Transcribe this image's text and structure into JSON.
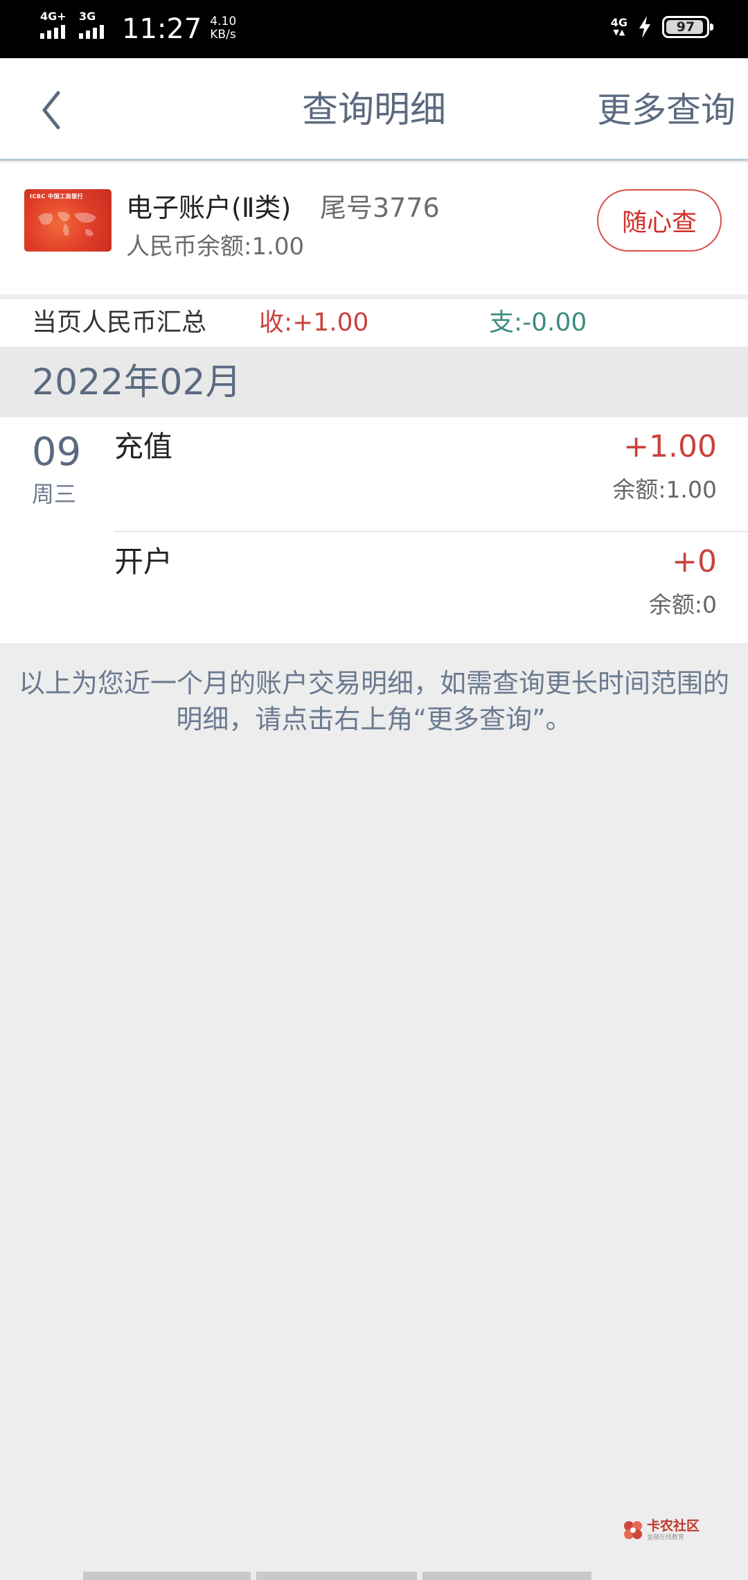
{
  "status_bar": {
    "network_1": "4G+",
    "network_2": "3G",
    "time": "11:27",
    "speed_value": "4.10",
    "speed_unit": "KB/s",
    "network_right": "4G",
    "battery": "97"
  },
  "nav": {
    "back_icon": "chevron-left-icon",
    "title": "查询明细",
    "more": "更多查询"
  },
  "account": {
    "card_logo": "ICBC 中国工商银行",
    "name": "电子账户(Ⅱ类)",
    "tail": "尾号3776",
    "balance": "人民币余额:1.00",
    "quick_query": "随心查"
  },
  "summary": {
    "label": "当页人民币汇总",
    "income": "收:+1.00",
    "expense": "支:-0.00"
  },
  "month": "2022年02月",
  "day_group": {
    "day": "09",
    "weekday": "周三",
    "transactions": [
      {
        "name": "充值",
        "amount": "+1.00",
        "balance": "余额:1.00"
      },
      {
        "name": "开户",
        "amount": "+0",
        "balance": "余额:0"
      }
    ]
  },
  "notice": "以上为您近一个月的账户交易明细，如需查询更长时间范围的明细，请点击右上角“更多查询”。",
  "watermark": {
    "main": "卡农社区",
    "sub": "金融在线教育"
  },
  "colors": {
    "accent_red": "#d12f2a",
    "expense_green": "#3d8c80",
    "title_slate": "#5b6a80"
  }
}
